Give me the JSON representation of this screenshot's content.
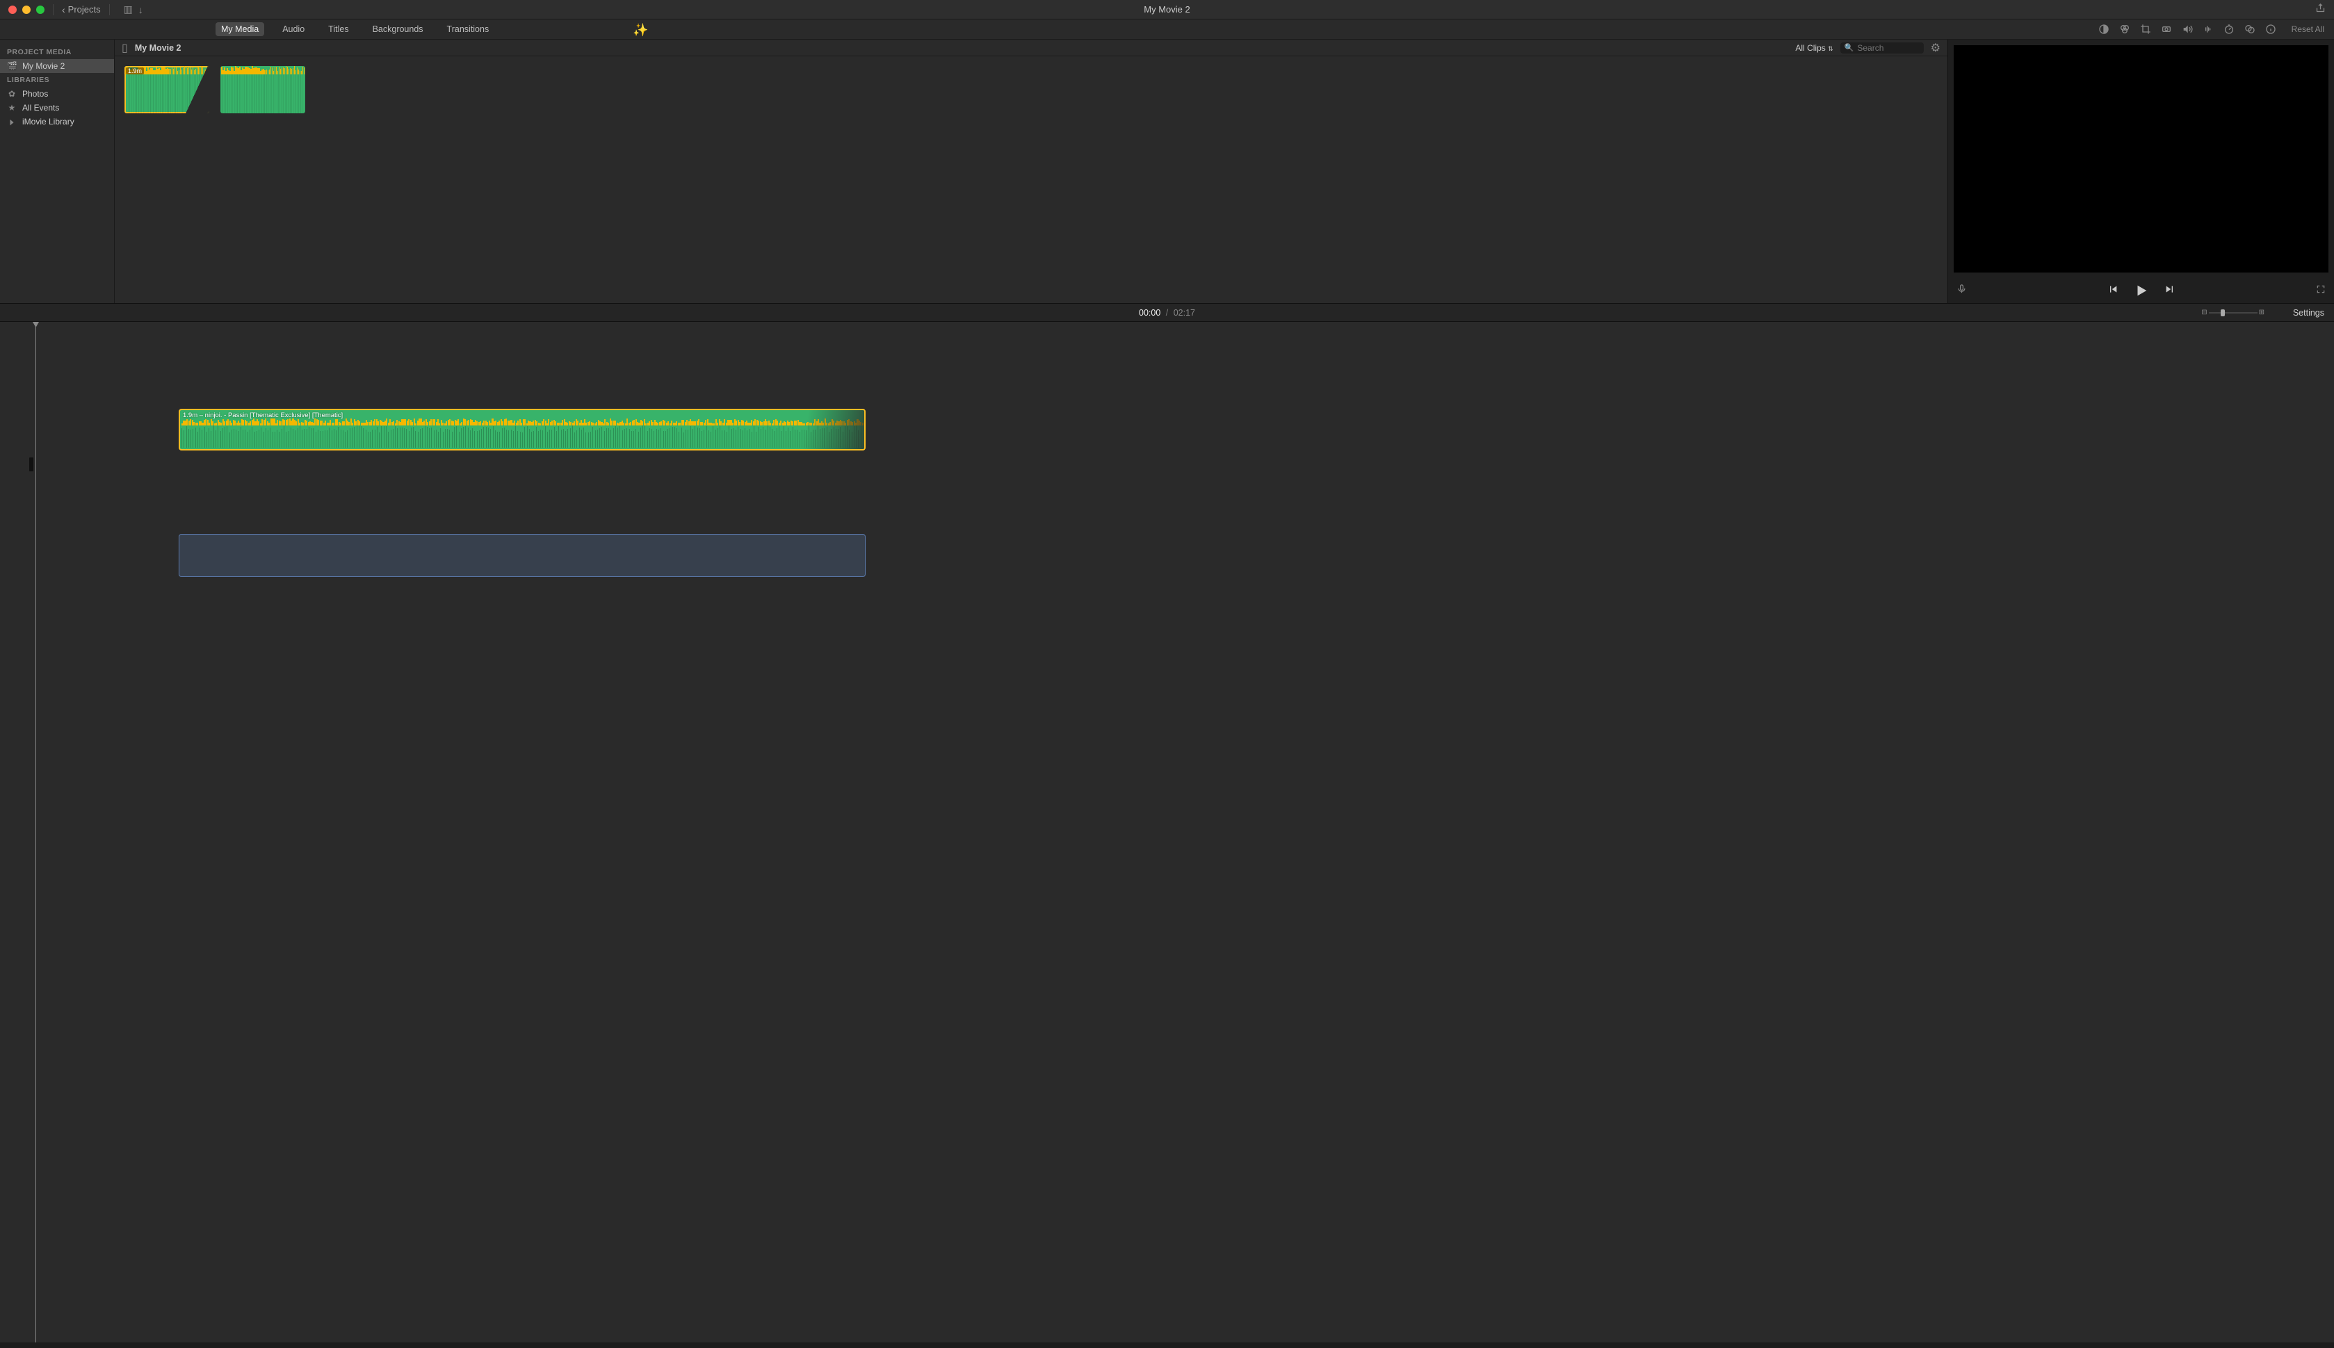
{
  "titlebar": {
    "projects": "Projects",
    "title": "My Movie 2"
  },
  "tabs": {
    "my_media": "My Media",
    "audio": "Audio",
    "titles": "Titles",
    "backgrounds": "Backgrounds",
    "transitions": "Transitions",
    "reset_all": "Reset All"
  },
  "sidebar": {
    "hdr_project": "PROJECT MEDIA",
    "project": "My Movie 2",
    "hdr_lib": "LIBRARIES",
    "photos": "Photos",
    "all_events": "All Events",
    "library": "iMovie Library"
  },
  "browser": {
    "project_name": "My Movie 2",
    "filter": "All Clips",
    "search_ph": "Search",
    "clip_duration": "1.9m"
  },
  "timeline": {
    "cur": "00:00",
    "sep": "/",
    "tot": "02:17",
    "settings": "Settings",
    "clip_label": "1.9m – ninjoi. - Passin [Thematic Exclusive] [Thematic]"
  }
}
